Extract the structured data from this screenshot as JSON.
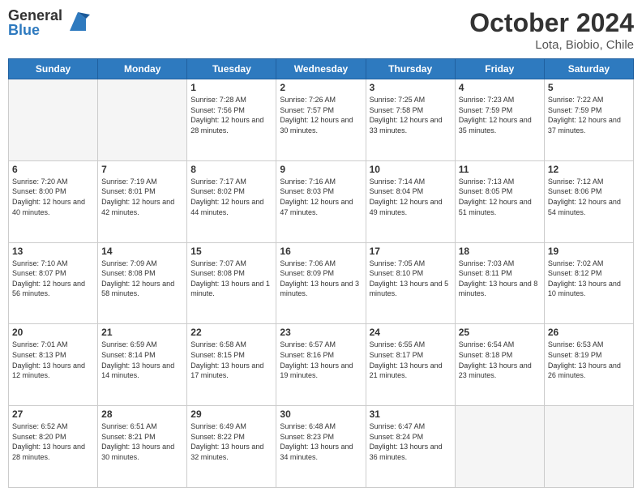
{
  "header": {
    "logo_general": "General",
    "logo_blue": "Blue",
    "month_title": "October 2024",
    "location": "Lota, Biobio, Chile"
  },
  "days_of_week": [
    "Sunday",
    "Monday",
    "Tuesday",
    "Wednesday",
    "Thursday",
    "Friday",
    "Saturday"
  ],
  "weeks": [
    [
      {
        "num": "",
        "empty": true
      },
      {
        "num": "",
        "empty": true
      },
      {
        "num": "1",
        "sunrise": "7:28 AM",
        "sunset": "7:56 PM",
        "daylight": "12 hours and 28 minutes."
      },
      {
        "num": "2",
        "sunrise": "7:26 AM",
        "sunset": "7:57 PM",
        "daylight": "12 hours and 30 minutes."
      },
      {
        "num": "3",
        "sunrise": "7:25 AM",
        "sunset": "7:58 PM",
        "daylight": "12 hours and 33 minutes."
      },
      {
        "num": "4",
        "sunrise": "7:23 AM",
        "sunset": "7:59 PM",
        "daylight": "12 hours and 35 minutes."
      },
      {
        "num": "5",
        "sunrise": "7:22 AM",
        "sunset": "7:59 PM",
        "daylight": "12 hours and 37 minutes."
      }
    ],
    [
      {
        "num": "6",
        "sunrise": "7:20 AM",
        "sunset": "8:00 PM",
        "daylight": "12 hours and 40 minutes."
      },
      {
        "num": "7",
        "sunrise": "7:19 AM",
        "sunset": "8:01 PM",
        "daylight": "12 hours and 42 minutes."
      },
      {
        "num": "8",
        "sunrise": "7:17 AM",
        "sunset": "8:02 PM",
        "daylight": "12 hours and 44 minutes."
      },
      {
        "num": "9",
        "sunrise": "7:16 AM",
        "sunset": "8:03 PM",
        "daylight": "12 hours and 47 minutes."
      },
      {
        "num": "10",
        "sunrise": "7:14 AM",
        "sunset": "8:04 PM",
        "daylight": "12 hours and 49 minutes."
      },
      {
        "num": "11",
        "sunrise": "7:13 AM",
        "sunset": "8:05 PM",
        "daylight": "12 hours and 51 minutes."
      },
      {
        "num": "12",
        "sunrise": "7:12 AM",
        "sunset": "8:06 PM",
        "daylight": "12 hours and 54 minutes."
      }
    ],
    [
      {
        "num": "13",
        "sunrise": "7:10 AM",
        "sunset": "8:07 PM",
        "daylight": "12 hours and 56 minutes."
      },
      {
        "num": "14",
        "sunrise": "7:09 AM",
        "sunset": "8:08 PM",
        "daylight": "12 hours and 58 minutes."
      },
      {
        "num": "15",
        "sunrise": "7:07 AM",
        "sunset": "8:08 PM",
        "daylight": "13 hours and 1 minute."
      },
      {
        "num": "16",
        "sunrise": "7:06 AM",
        "sunset": "8:09 PM",
        "daylight": "13 hours and 3 minutes."
      },
      {
        "num": "17",
        "sunrise": "7:05 AM",
        "sunset": "8:10 PM",
        "daylight": "13 hours and 5 minutes."
      },
      {
        "num": "18",
        "sunrise": "7:03 AM",
        "sunset": "8:11 PM",
        "daylight": "13 hours and 8 minutes."
      },
      {
        "num": "19",
        "sunrise": "7:02 AM",
        "sunset": "8:12 PM",
        "daylight": "13 hours and 10 minutes."
      }
    ],
    [
      {
        "num": "20",
        "sunrise": "7:01 AM",
        "sunset": "8:13 PM",
        "daylight": "13 hours and 12 minutes."
      },
      {
        "num": "21",
        "sunrise": "6:59 AM",
        "sunset": "8:14 PM",
        "daylight": "13 hours and 14 minutes."
      },
      {
        "num": "22",
        "sunrise": "6:58 AM",
        "sunset": "8:15 PM",
        "daylight": "13 hours and 17 minutes."
      },
      {
        "num": "23",
        "sunrise": "6:57 AM",
        "sunset": "8:16 PM",
        "daylight": "13 hours and 19 minutes."
      },
      {
        "num": "24",
        "sunrise": "6:55 AM",
        "sunset": "8:17 PM",
        "daylight": "13 hours and 21 minutes."
      },
      {
        "num": "25",
        "sunrise": "6:54 AM",
        "sunset": "8:18 PM",
        "daylight": "13 hours and 23 minutes."
      },
      {
        "num": "26",
        "sunrise": "6:53 AM",
        "sunset": "8:19 PM",
        "daylight": "13 hours and 26 minutes."
      }
    ],
    [
      {
        "num": "27",
        "sunrise": "6:52 AM",
        "sunset": "8:20 PM",
        "daylight": "13 hours and 28 minutes."
      },
      {
        "num": "28",
        "sunrise": "6:51 AM",
        "sunset": "8:21 PM",
        "daylight": "13 hours and 30 minutes."
      },
      {
        "num": "29",
        "sunrise": "6:49 AM",
        "sunset": "8:22 PM",
        "daylight": "13 hours and 32 minutes."
      },
      {
        "num": "30",
        "sunrise": "6:48 AM",
        "sunset": "8:23 PM",
        "daylight": "13 hours and 34 minutes."
      },
      {
        "num": "31",
        "sunrise": "6:47 AM",
        "sunset": "8:24 PM",
        "daylight": "13 hours and 36 minutes."
      },
      {
        "num": "",
        "empty": true
      },
      {
        "num": "",
        "empty": true
      }
    ]
  ]
}
